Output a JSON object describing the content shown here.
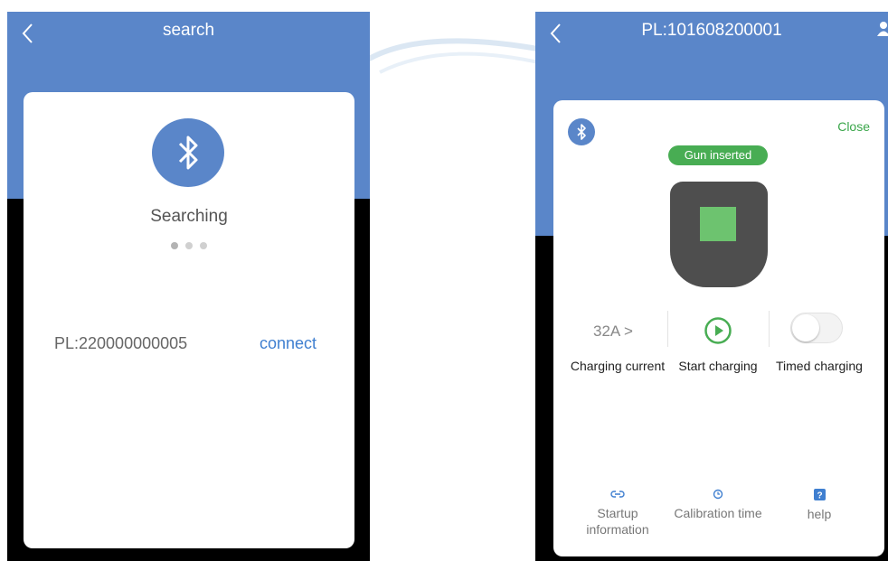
{
  "colors": {
    "header_blue": "#5a86c9",
    "link_blue": "#3f7fd0",
    "status_green": "#48ad53",
    "charger_gray": "#4e4e4e",
    "charger_screen_green": "#6dc36f"
  },
  "search_screen": {
    "title": "search",
    "back_icon": "chevron-left-icon",
    "bluetooth_icon": "bluetooth-icon",
    "status_text": "Searching",
    "loading_dots": 3,
    "device": {
      "id": "PL:220000000005",
      "action_label": "connect"
    }
  },
  "charger_screen": {
    "title": "PL:101608200001",
    "back_icon": "chevron-left-icon",
    "user_icon": "user-icon",
    "bluetooth_icon": "bluetooth-icon",
    "close_label": "Close",
    "status_badge": "Gun inserted",
    "controls": {
      "current_value": "32A >",
      "current_label": "Charging current",
      "start_label": "Start charging",
      "start_icon": "play-circle-icon",
      "timed_label": "Timed charging",
      "timed_enabled": false
    },
    "bottom_nav": [
      {
        "label_line1": "Startup",
        "label_line2": "information",
        "icon": "link-icon"
      },
      {
        "label_line1": "Calibration time",
        "label_line2": "",
        "icon": "clock-icon"
      },
      {
        "label_line1": "help",
        "label_line2": "",
        "icon": "help-icon"
      }
    ]
  }
}
